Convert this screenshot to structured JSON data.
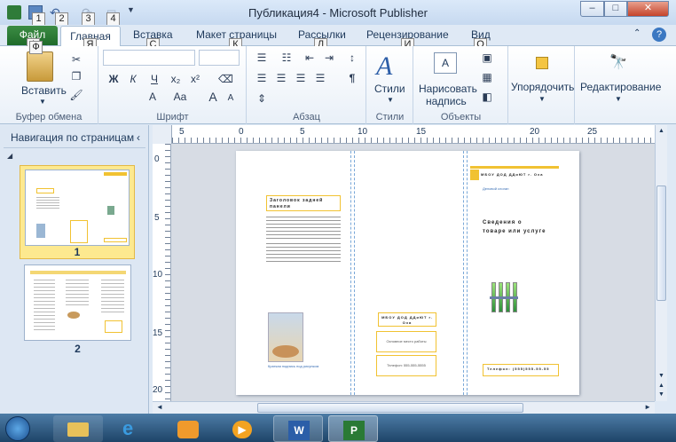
{
  "window": {
    "title": "Публикация4  -  Microsoft Publisher",
    "minimize": "–",
    "maximize": "□",
    "close": "✕"
  },
  "qat_keytips": [
    "1",
    "2",
    "3",
    "4"
  ],
  "tabs": [
    {
      "label": "Файл",
      "keytip": "Ф"
    },
    {
      "label": "Главная",
      "keytip": "Я"
    },
    {
      "label": "Вставка",
      "keytip": "С"
    },
    {
      "label": "Макет страницы",
      "keytip": "К"
    },
    {
      "label": "Рассылки",
      "keytip": "Л"
    },
    {
      "label": "Рецензирование",
      "keytip": "И"
    },
    {
      "label": "Вид",
      "keytip": "О"
    }
  ],
  "ribbon": {
    "clipboard": {
      "label": "Буфер обмена",
      "paste": "Вставить"
    },
    "font": {
      "label": "Шрифт",
      "bold": "Ж",
      "italic": "К",
      "underline": "Ч",
      "subscript": "x₂",
      "superscript": "x²",
      "grow": "A",
      "shrink": "A",
      "case": "Aa",
      "color": "A"
    },
    "paragraph": {
      "label": "Абзац",
      "pilcrow": "¶"
    },
    "styles": {
      "label": "Стили",
      "styles_btn": "Стили"
    },
    "objects": {
      "label": "Объекты",
      "draw_textbox_line1": "Нарисовать",
      "draw_textbox_line2": "надпись"
    },
    "arrange": {
      "label": "Упорядочить"
    },
    "editing": {
      "label": "Редактирование"
    }
  },
  "nav_pane": {
    "title": "Навигация по страницам",
    "pages": [
      "1",
      "2"
    ]
  },
  "ruler": {
    "horizontal": [
      "5",
      "0",
      "5",
      "10",
      "15",
      "20",
      "25"
    ],
    "vertical": [
      "0",
      "5",
      "10",
      "15",
      "20"
    ]
  },
  "publication": {
    "panel1_heading": "Заголовок задней панели",
    "panel1_caption": "Краткая подпись под рисунком",
    "panel2_org": "МБОУ ДОД ДДиЮТ г. Оха",
    "panel2_box1": "Основное место работы",
    "panel2_box2": "Телефон: 555-555-5555",
    "panel3_org": "МБОУ ДОД ДДиЮТ г. Оха",
    "panel3_subtitle": "Деловой слоган",
    "panel3_title_line1": "Сведения о",
    "panel3_title_line2": "товаре или услуге",
    "panel3_phone": "Телефон: (555)555-55-55"
  },
  "colors": {
    "accent": "#f1c232",
    "file_tab": "#2a7a35"
  }
}
